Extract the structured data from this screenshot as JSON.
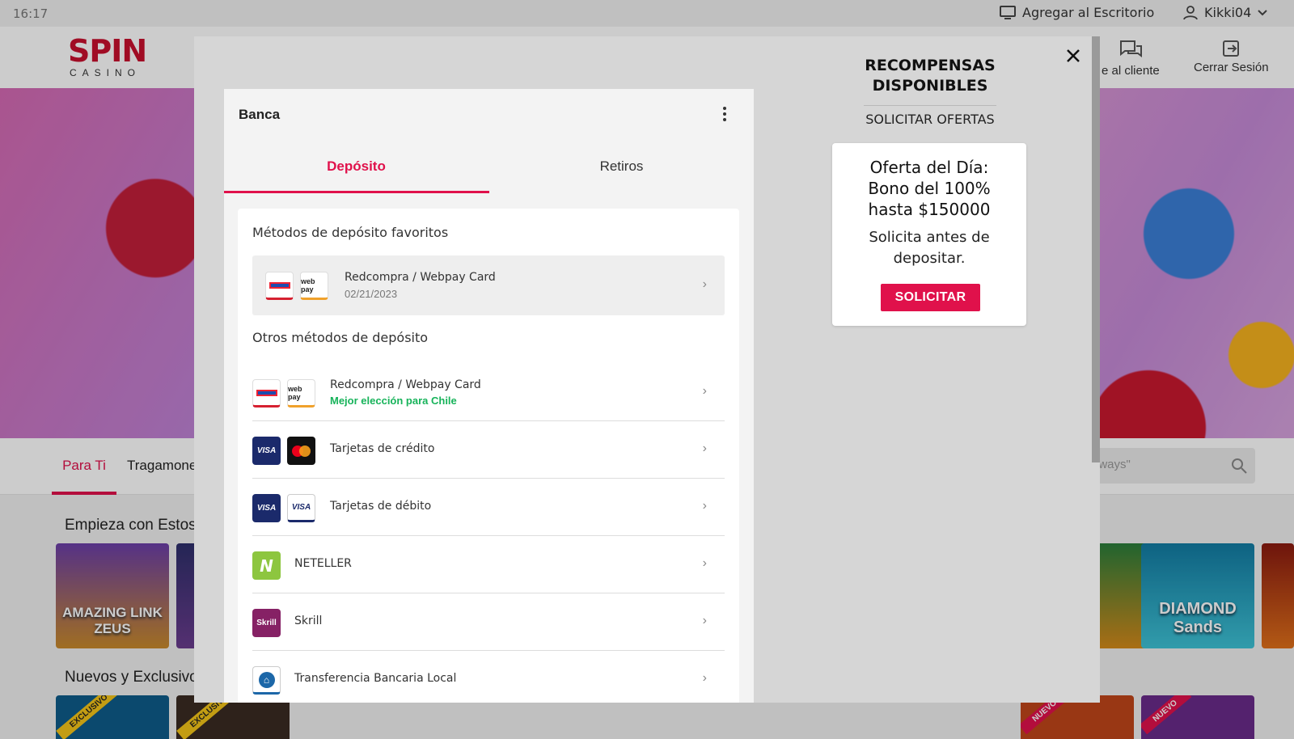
{
  "statusbar": {
    "time": "16:17",
    "add_desktop": "Agregar al Escritorio",
    "username": "Kikki04"
  },
  "header": {
    "logo_main": "SPIN",
    "logo_sub": "CASINO",
    "support_label": "e al cliente",
    "logout_label": "Cerrar Sesión"
  },
  "page": {
    "tabs": [
      "Para Ti",
      "Tragamone"
    ],
    "search_placeholder": "aways\"",
    "section1": "Empieza con Estos",
    "section2": "Nuevos y Exclusivo",
    "tiles_row1": [
      "AMAZING LINK ZEUS",
      "DIAMOND Sands"
    ],
    "ribbon_exclusive": "EXCLUSIVO",
    "ribbon_new": "NUEVO"
  },
  "banking": {
    "title": "Banca",
    "tabs": {
      "deposit": "Depósito",
      "withdrawals": "Retiros"
    },
    "favorites_heading": "Métodos de depósito favoritos",
    "favorite": {
      "name": "Redcompra / Webpay Card",
      "date": "02/21/2023"
    },
    "others_heading": "Otros métodos de depósito",
    "methods": [
      {
        "name": "Redcompra / Webpay Card",
        "note": "Mejor elección para Chile"
      },
      {
        "name": "Tarjetas de crédito"
      },
      {
        "name": "Tarjetas de débito"
      },
      {
        "name": "NETELLER"
      },
      {
        "name": "Skrill"
      },
      {
        "name": "Transferencia Bancaria Local"
      }
    ],
    "logo_text": {
      "visa": "VISA",
      "webpay": "web pay",
      "neteller": "N",
      "skrill": "Skrill"
    }
  },
  "rewards": {
    "title_line1": "RECOMPENSAS",
    "title_line2": "DISPONIBLES",
    "request_offers": "SOLICITAR OFERTAS",
    "offer": {
      "title_line1": "Oferta del Día:",
      "title_line2": "Bono del 100%",
      "title_line3": "hasta $150000",
      "desc_line1": "Solicita antes de",
      "desc_line2": "depositar.",
      "button": "SOLICITAR"
    }
  },
  "colors": {
    "accent": "#e0114b",
    "success": "#17b35a",
    "modal_bg": "#d6d6d6"
  }
}
